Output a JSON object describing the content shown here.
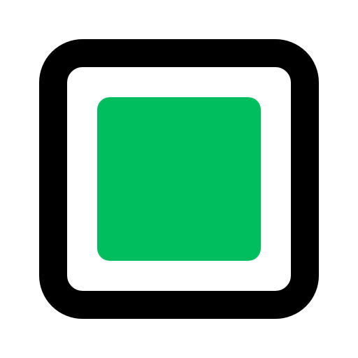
{
  "icon": {
    "name": "checkbox-filled-icon",
    "state": "checked",
    "colors": {
      "background": "#ffffff",
      "outline": "#000000",
      "fill": "#00bd5d"
    }
  }
}
